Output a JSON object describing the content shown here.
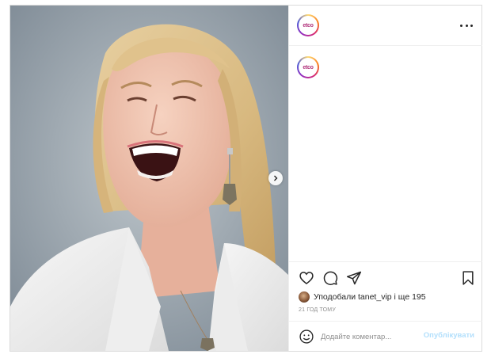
{
  "post": {
    "avatar_text": "etco",
    "likes_prefix": "Уподобали",
    "likes_user": "tanet_vip",
    "likes_suffix": "і ще 195",
    "timestamp": "21 ГОД ТОМУ"
  },
  "comment": {
    "placeholder": "Додайте коментар...",
    "post_label": "Опублікувати"
  },
  "icons": {
    "more": "more-horizontal-icon",
    "like": "heart-icon",
    "comment": "comment-icon",
    "share": "paper-plane-icon",
    "save": "bookmark-icon",
    "emoji": "smile-icon",
    "next": "chevron-right-icon"
  },
  "colors": {
    "post_button_disabled": "#b2dffc",
    "border": "#dbdbdb",
    "muted_text": "#8e8e8e"
  }
}
